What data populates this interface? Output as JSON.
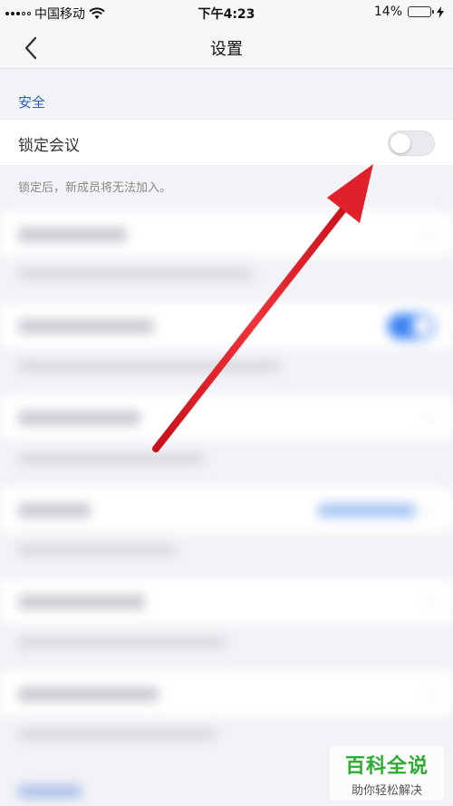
{
  "status_bar": {
    "carrier": "中国移动",
    "time": "下午4:23",
    "battery_percent": "14%",
    "battery_level": 0.14
  },
  "nav": {
    "title": "设置"
  },
  "security": {
    "section_title": "安全",
    "lock_meeting_label": "锁定会议",
    "lock_meeting_enabled": false,
    "lock_meeting_hint": "锁定后，新成员将无法加入。"
  },
  "watermark": {
    "title": "百科全说",
    "subtitle": "助你轻松解决"
  },
  "colors": {
    "accent": "#2f5dbb",
    "toggle_off": "#e9eaee",
    "arrow": "#e0202a",
    "watermark_green": "#2eab33"
  }
}
